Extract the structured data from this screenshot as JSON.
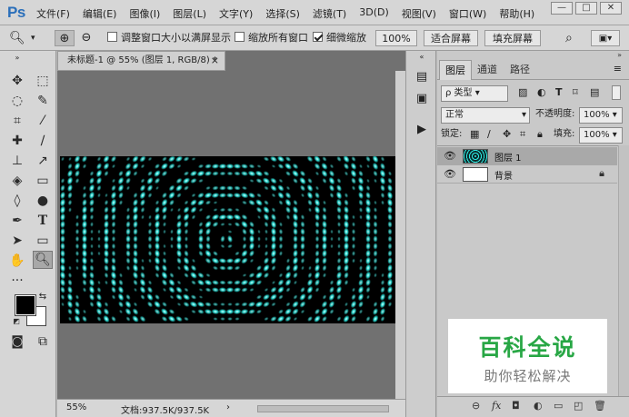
{
  "app": {
    "logo": "Ps"
  },
  "menu": [
    "文件(F)",
    "编辑(E)",
    "图像(I)",
    "图层(L)",
    "文字(Y)",
    "选择(S)",
    "滤镜(T)",
    "3D(D)",
    "视图(V)",
    "窗口(W)",
    "帮助(H)"
  ],
  "window_controls": {
    "minimize": "—",
    "maximize": "□",
    "close": "✕"
  },
  "options": {
    "resize_windows": "调整窗口大小以满屏显示",
    "resize_windows_checked": false,
    "zoom_all": "缩放所有窗口",
    "zoom_all_checked": false,
    "scrubby_zoom": "细微缩放",
    "scrubby_zoom_checked": true,
    "zoom_percent": "100%",
    "fit_screen": "适合屏幕",
    "fill_screen": "填充屏幕"
  },
  "document": {
    "tab_title": "未标题-1 @ 55% (图层 1, RGB/8) *",
    "close_glyph": "×",
    "zoom": "55%",
    "doc_info": "文档:937.5K/937.5K",
    "canvas_colors": {
      "background": "#000000",
      "glow": "#2ee8e0"
    }
  },
  "colors": {
    "foreground": "#000000",
    "background": "#ffffff",
    "accent_teal": "#2ee8e0"
  },
  "layers_panel": {
    "tabs": [
      "图层",
      "通道",
      "路径"
    ],
    "active_tab": "图层",
    "filter_kind": "类型",
    "blend_mode": "正常",
    "opacity_label": "不透明度:",
    "opacity_value": "100%",
    "lock_label": "锁定:",
    "fill_label": "填充:",
    "fill_value": "100%",
    "layers": [
      {
        "name": "图层 1",
        "selected": true,
        "locked": false,
        "visible": true
      },
      {
        "name": "背景",
        "selected": false,
        "locked": true,
        "visible": true
      }
    ],
    "footer_icons": [
      "link-icon",
      "fx-icon",
      "mask-icon",
      "adjustment-icon",
      "group-icon",
      "new-layer-icon",
      "trash-icon"
    ],
    "footer_labels": {
      "link": "⊖",
      "fx": "fx"
    }
  },
  "watermark": {
    "title": "百科全说",
    "subtitle": "助你轻松解决"
  }
}
